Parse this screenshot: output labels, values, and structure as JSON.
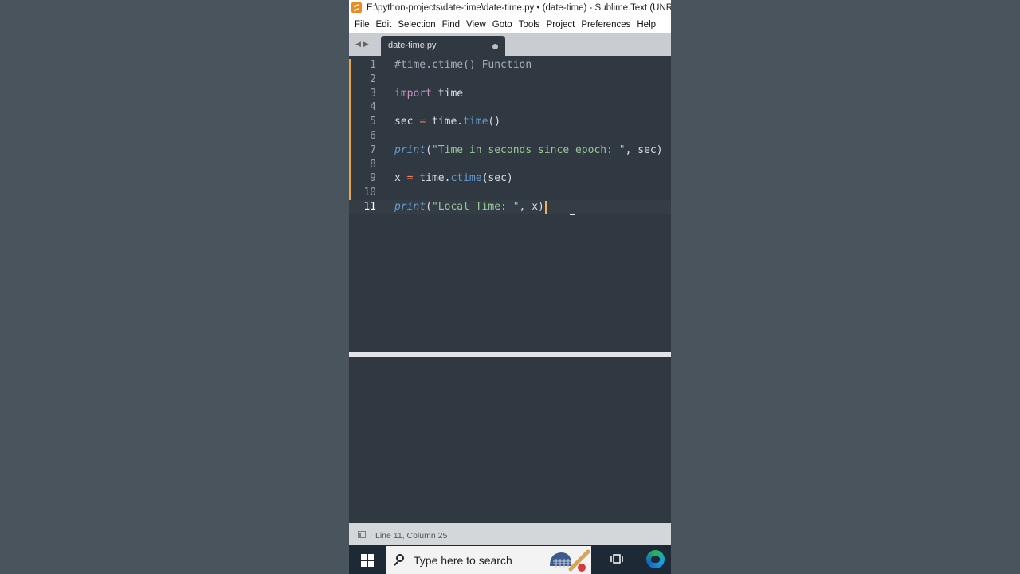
{
  "window": {
    "title": "E:\\python-projects\\date-time\\date-time.py • (date-time) - Sublime Text (UNREGISTERED)"
  },
  "menu": [
    "File",
    "Edit",
    "Selection",
    "Find",
    "View",
    "Goto",
    "Tools",
    "Project",
    "Preferences",
    "Help"
  ],
  "tab": {
    "label": "date-time.py",
    "dirty": true
  },
  "editor": {
    "lines": [
      {
        "n": "1",
        "tokens": [
          {
            "t": "#time.ctime() Function",
            "c": "cm"
          }
        ]
      },
      {
        "n": "2",
        "tokens": []
      },
      {
        "n": "3",
        "tokens": [
          {
            "t": "import",
            "c": "kw"
          },
          {
            "t": " time",
            "c": ""
          }
        ]
      },
      {
        "n": "4",
        "tokens": []
      },
      {
        "n": "5",
        "tokens": [
          {
            "t": "sec ",
            "c": ""
          },
          {
            "t": "=",
            "c": "op"
          },
          {
            "t": " time.",
            "c": ""
          },
          {
            "t": "time",
            "c": "fn"
          },
          {
            "t": "()",
            "c": ""
          }
        ]
      },
      {
        "n": "6",
        "tokens": []
      },
      {
        "n": "7",
        "tokens": [
          {
            "t": "print",
            "c": "it"
          },
          {
            "t": "(",
            "c": ""
          },
          {
            "t": "\"Time in seconds since epoch: \"",
            "c": "str"
          },
          {
            "t": ", sec)",
            "c": ""
          }
        ]
      },
      {
        "n": "8",
        "tokens": []
      },
      {
        "n": "9",
        "tokens": [
          {
            "t": "x ",
            "c": ""
          },
          {
            "t": "=",
            "c": "op"
          },
          {
            "t": " time.",
            "c": ""
          },
          {
            "t": "ctime",
            "c": "fn"
          },
          {
            "t": "(sec)",
            "c": ""
          }
        ]
      },
      {
        "n": "10",
        "tokens": []
      },
      {
        "n": "11",
        "tokens": [
          {
            "t": "print",
            "c": "it"
          },
          {
            "t": "(",
            "c": ""
          },
          {
            "t": "\"Local Time: \"",
            "c": "str"
          },
          {
            "t": ", x)",
            "c": ""
          }
        ]
      }
    ],
    "active_line": 11
  },
  "status": {
    "text": "Line 11, Column 25"
  },
  "taskbar": {
    "search_placeholder": "Type here to search"
  }
}
